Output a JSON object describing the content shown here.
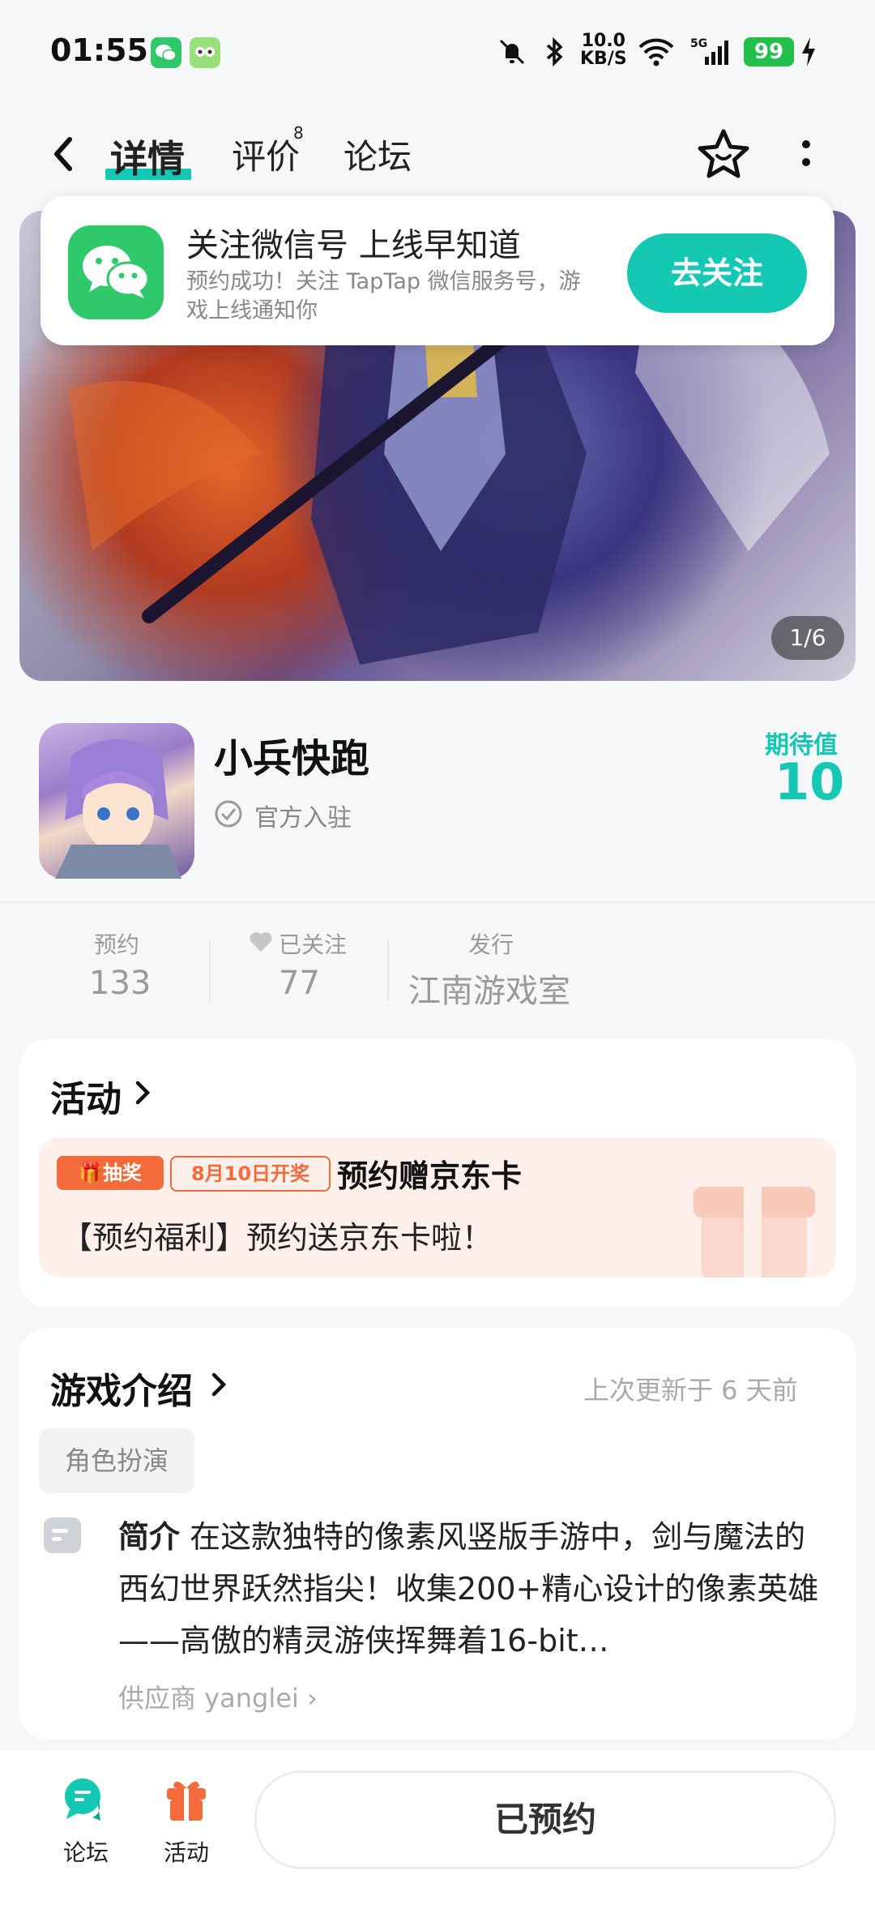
{
  "status_bar": {
    "time": "01:55",
    "network_speed": "10.0\nKB/S",
    "battery": "99",
    "icons": [
      "wechat-icon",
      "app-icon",
      "mute-icon",
      "bluetooth-icon",
      "wifi-icon",
      "signal-icon",
      "charging-icon"
    ]
  },
  "header": {
    "tabs": [
      {
        "label": "详情",
        "active": true
      },
      {
        "label": "评价",
        "badge": "8"
      },
      {
        "label": "论坛"
      }
    ]
  },
  "banner": {
    "counter": "1/6"
  },
  "popup": {
    "title": "关注微信号 上线早知道",
    "subtitle": "预约成功！关注 TapTap 微信服务号，游戏上线通知你",
    "button": "去关注"
  },
  "game": {
    "name": "小兵快跑",
    "official_label": "官方入驻",
    "expectation_label": "期待值",
    "expectation_value": "10"
  },
  "stats": [
    {
      "label": "预约",
      "value": "133"
    },
    {
      "label": "已关注",
      "value": "77"
    },
    {
      "label": "发行",
      "value": "江南游戏室"
    }
  ],
  "activity": {
    "title": "活动",
    "badge_type": "抽奖",
    "badge_date": "8月10日开奖",
    "event_title": "预约赠京东卡",
    "event_desc": "【预约福利】预约送京东卡啦！"
  },
  "intro": {
    "title": "游戏介绍",
    "updated": "上次更新于 6 天前",
    "tag": "角色扮演",
    "label": "简介",
    "text": "在这款独特的像素风竖版手游中，剑与魔法的西幻世界跃然指尖！收集200+精心设计的像素英雄——高傲的精灵游侠挥舞着16-bit…",
    "supplier": "供应商 yanglei"
  },
  "bottom_bar": {
    "forum_label": "论坛",
    "activity_label": "活动",
    "reserve_button": "已预约"
  },
  "colors": {
    "accent": "#14c8b4",
    "orange": "#f36b3a",
    "wechat_green": "#2fc86a"
  }
}
